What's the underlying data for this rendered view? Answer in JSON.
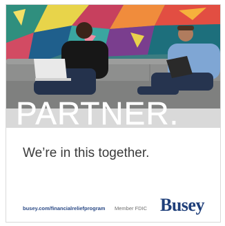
{
  "ad": {
    "headline": "PARTNER.",
    "tagline": "We’re in this together.",
    "url": "busey.com/financialreliefprogram",
    "disclosure": "Member FDIC",
    "brand": "Busey"
  },
  "colors": {
    "brand_blue": "#1f3f7a",
    "url_blue": "#2b4a86",
    "tagline_gray": "#3a3a3a",
    "couch_gray": "#8e8f8e"
  }
}
